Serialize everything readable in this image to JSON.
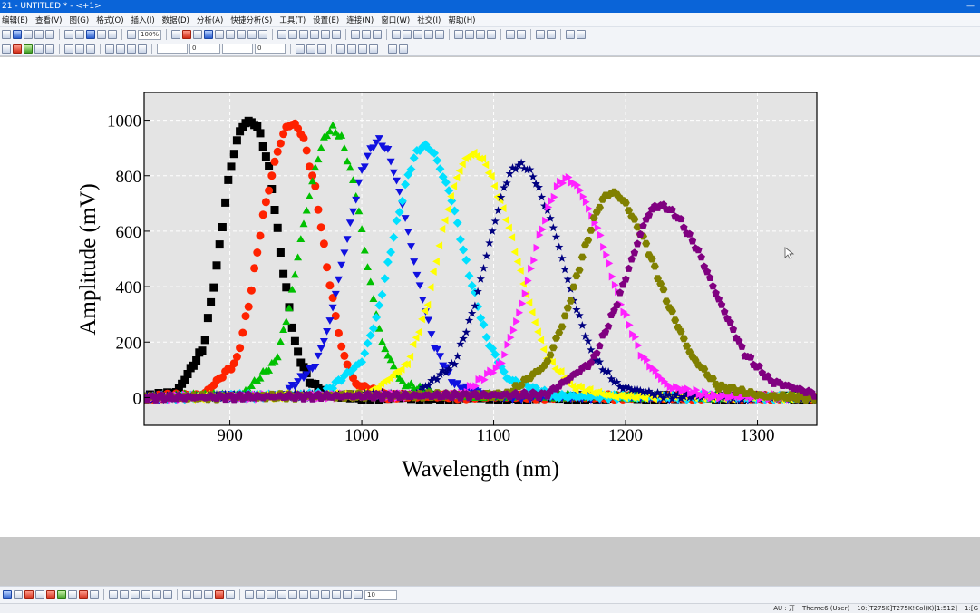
{
  "window": {
    "title": "21 - UNTITLED * - <+1>"
  },
  "menu": [
    "编辑(E)",
    "查看(V)",
    "图(G)",
    "格式(O)",
    "插入(I)",
    "数据(D)",
    "分析(A)",
    "快捷分析(S)",
    "工具(T)",
    "设置(E)",
    "连接(N)",
    "窗口(W)",
    "社交(I)",
    "帮助(H)"
  ],
  "toolbar": {
    "zoom": "100%",
    "line_width_1": "0",
    "line_width_2": "0",
    "font_size": "10"
  },
  "statusbar": {
    "au": "AU : 开",
    "theme": "Theme6 (User)",
    "cell": "10:[T275K]T275K!Col(K)[1:512]",
    "extra": "1:[G"
  },
  "colors": {
    "plot_bg": "#e4e4e4",
    "series": [
      "#000000",
      "#ff2200",
      "#00c000",
      "#1010e0",
      "#00e0ff",
      "#ffff00",
      "#000080",
      "#ff20ff",
      "#808000",
      "#800080"
    ]
  },
  "chart_data": {
    "type": "scatter",
    "title": "",
    "xlabel": "Wavelength (nm)",
    "ylabel": "Amplitude (mV)",
    "xlim": [
      835,
      1345
    ],
    "ylim": [
      -100,
      1100
    ],
    "xticks": [
      900,
      1000,
      1100,
      1200,
      1300
    ],
    "yticks": [
      0,
      200,
      400,
      600,
      800,
      1000
    ],
    "grid": true,
    "legend": "none",
    "series": [
      {
        "marker": "square",
        "color": "#000000",
        "x": [
          835,
          860,
          880,
          890,
          900,
          908,
          915,
          922,
          930,
          940,
          950,
          960,
          975,
          1000,
          1345
        ],
        "y": [
          0,
          20,
          180,
          470,
          820,
          970,
          1000,
          970,
          820,
          470,
          180,
          60,
          10,
          0,
          0
        ]
      },
      {
        "marker": "circle",
        "color": "#ff2200",
        "x": [
          835,
          880,
          905,
          915,
          925,
          935,
          942,
          948,
          955,
          965,
          975,
          985,
          995,
          1020,
          1345
        ],
        "y": [
          0,
          10,
          130,
          350,
          650,
          870,
          970,
          990,
          950,
          750,
          430,
          170,
          50,
          5,
          0
        ]
      },
      {
        "marker": "triangle-up",
        "color": "#00c000",
        "x": [
          835,
          910,
          935,
          945,
          955,
          965,
          972,
          978,
          985,
          995,
          1005,
          1015,
          1030,
          1060,
          1345
        ],
        "y": [
          0,
          10,
          130,
          320,
          600,
          830,
          940,
          970,
          930,
          750,
          450,
          200,
          50,
          5,
          0
        ]
      },
      {
        "marker": "triangle-down",
        "color": "#1010e0",
        "x": [
          835,
          940,
          965,
          975,
          990,
          1000,
          1008,
          1013,
          1020,
          1030,
          1042,
          1055,
          1070,
          1100,
          1345
        ],
        "y": [
          0,
          10,
          120,
          260,
          600,
          820,
          910,
          930,
          890,
          720,
          440,
          190,
          50,
          5,
          0
        ]
      },
      {
        "marker": "diamond",
        "color": "#00e0ff",
        "x": [
          835,
          970,
          1000,
          1012,
          1025,
          1035,
          1042,
          1048,
          1055,
          1068,
          1080,
          1095,
          1110,
          1145,
          1345
        ],
        "y": [
          0,
          10,
          130,
          300,
          600,
          800,
          890,
          910,
          880,
          720,
          470,
          210,
          70,
          5,
          0
        ]
      },
      {
        "marker": "triangle-left",
        "color": "#ffff00",
        "x": [
          835,
          1005,
          1035,
          1050,
          1062,
          1072,
          1080,
          1087,
          1095,
          1110,
          1125,
          1140,
          1160,
          1190,
          1345
        ],
        "y": [
          0,
          10,
          120,
          330,
          610,
          790,
          870,
          880,
          840,
          650,
          380,
          150,
          40,
          5,
          0
        ]
      },
      {
        "marker": "star",
        "color": "#000080",
        "x": [
          835,
          1040,
          1070,
          1085,
          1098,
          1108,
          1115,
          1122,
          1130,
          1145,
          1160,
          1175,
          1195,
          1230,
          1345
        ],
        "y": [
          0,
          10,
          120,
          320,
          580,
          760,
          830,
          840,
          800,
          620,
          360,
          150,
          40,
          5,
          0
        ]
      },
      {
        "marker": "triangle-right",
        "color": "#ff20ff",
        "x": [
          835,
          1075,
          1105,
          1120,
          1133,
          1143,
          1150,
          1157,
          1165,
          1180,
          1195,
          1212,
          1232,
          1265,
          1345
        ],
        "y": [
          0,
          10,
          120,
          320,
          560,
          710,
          780,
          790,
          750,
          590,
          350,
          150,
          40,
          5,
          0
        ]
      },
      {
        "marker": "hexagon",
        "color": "#808000",
        "x": [
          835,
          1110,
          1140,
          1155,
          1168,
          1178,
          1185,
          1192,
          1200,
          1215,
          1232,
          1250,
          1270,
          1305,
          1345
        ],
        "y": [
          0,
          10,
          120,
          300,
          520,
          670,
          730,
          740,
          700,
          560,
          340,
          150,
          40,
          5,
          0
        ]
      },
      {
        "marker": "pentagon",
        "color": "#800080",
        "x": [
          835,
          1140,
          1175,
          1192,
          1205,
          1215,
          1222,
          1230,
          1240,
          1255,
          1270,
          1290,
          1310,
          1345
        ],
        "y": [
          0,
          10,
          130,
          320,
          500,
          640,
          690,
          690,
          650,
          530,
          360,
          160,
          60,
          10
        ]
      }
    ]
  }
}
